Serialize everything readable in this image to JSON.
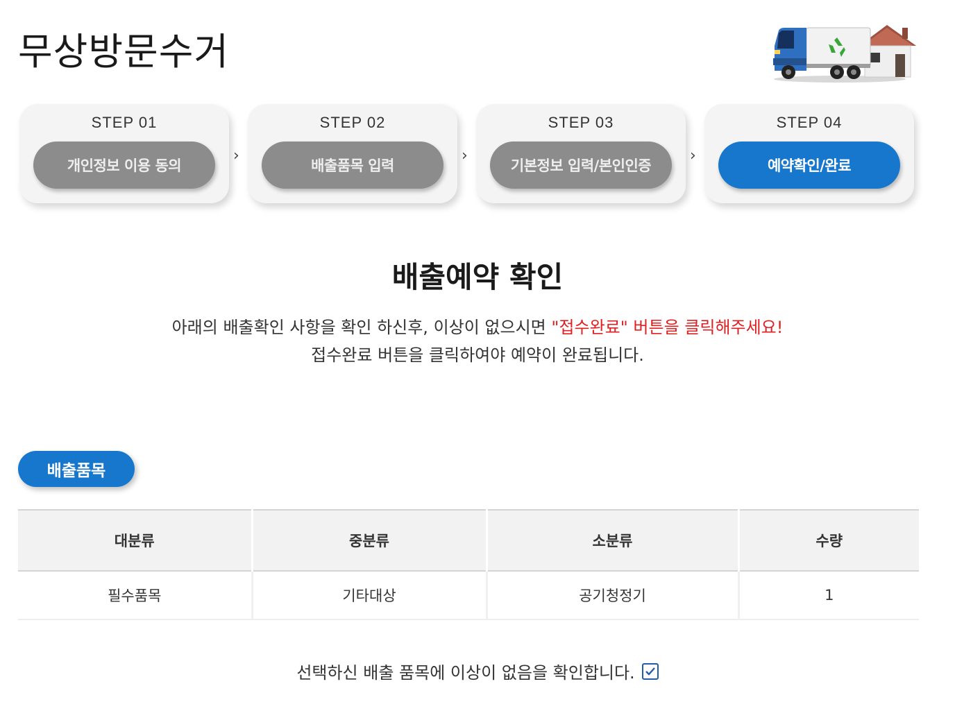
{
  "page": {
    "title": "무상방문수거"
  },
  "steps": [
    {
      "label": "STEP 01",
      "button": "개인정보 이용 동의",
      "active": false
    },
    {
      "label": "STEP 02",
      "button": "배출품목 입력",
      "active": false
    },
    {
      "label": "STEP 03",
      "button": "기본정보 입력/본인인증",
      "active": false
    },
    {
      "label": "STEP 04",
      "button": "예약확인/완료",
      "active": true
    }
  ],
  "step_separator": "›",
  "confirm": {
    "title": "배출예약 확인",
    "desc_line1_before": "아래의 배출확인 사항을 확인 하신후, 이상이 없으시면 ",
    "desc_line1_highlight": "\"접수완료\" 버튼을 클릭해주세요!",
    "desc_line2": "접수완료 버튼을 클릭하여야 예약이 완료됩니다."
  },
  "section": {
    "label": "배출품목"
  },
  "table": {
    "headers": [
      "대분류",
      "중분류",
      "소분류",
      "수량"
    ],
    "rows": [
      [
        "필수품목",
        "기타대상",
        "공기청정기",
        "1"
      ]
    ]
  },
  "agree": {
    "text": "선택하신 배출 품목에 이상이 없음을 확인합니다.",
    "checked": true
  },
  "colors": {
    "accent": "#1777cc",
    "inactive_pill": "#8c8c8c",
    "highlight_text": "#e02020"
  }
}
